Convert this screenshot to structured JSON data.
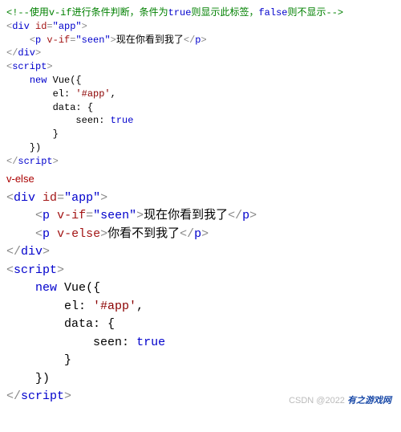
{
  "block1": {
    "comment_open": "<!--",
    "comment_text1": "使用",
    "comment_kw1": "v-if",
    "comment_text2": "进行条件判断，条件为",
    "comment_true": "true",
    "comment_text3": "则显示此标签，",
    "comment_false": "false",
    "comment_text4": "则不显示",
    "comment_close": "-->",
    "div_open_lt": "<",
    "div_tag": "div",
    "id_attr": "id",
    "eq": "=",
    "app_val": "\"app\"",
    "gt": ">",
    "p_tag": "p",
    "vif_attr": "v-if",
    "seen_val": "\"seen\"",
    "p_text": "现在你看到我了",
    "close_p": "</",
    "close_div": "</",
    "script_tag": "script",
    "new_kw": "new",
    "vue_id": "Vue",
    "paren_open": "({",
    "el_key": "el:",
    "el_val": "'#app'",
    "comma": ",",
    "data_key": "data:",
    "brace_open": "{",
    "seen_key": "seen:",
    "true_val": "true",
    "brace_close": "}",
    "paren_close": "})"
  },
  "section_label": "v-else",
  "block2": {
    "div_tag": "div",
    "id_attr": "id",
    "app_val": "\"app\"",
    "p_tag": "p",
    "vif_attr": "v-if",
    "seen_val": "\"seen\"",
    "p1_text": "现在你看到我了",
    "velse_attr": "v-else",
    "p2_text": "你看不到我了",
    "script_tag": "script",
    "new_kw": "new",
    "vue_id": "Vue",
    "paren_open": "({",
    "el_key": "el:",
    "el_val": "'#app'",
    "comma": ",",
    "data_key": "data:",
    "brace_open": "{",
    "seen_key": "seen:",
    "true_val": "true",
    "brace_close": "}",
    "paren_close": "})"
  },
  "watermark": {
    "csdn": "CSDN @2022",
    "logo": "有之游戏网"
  }
}
